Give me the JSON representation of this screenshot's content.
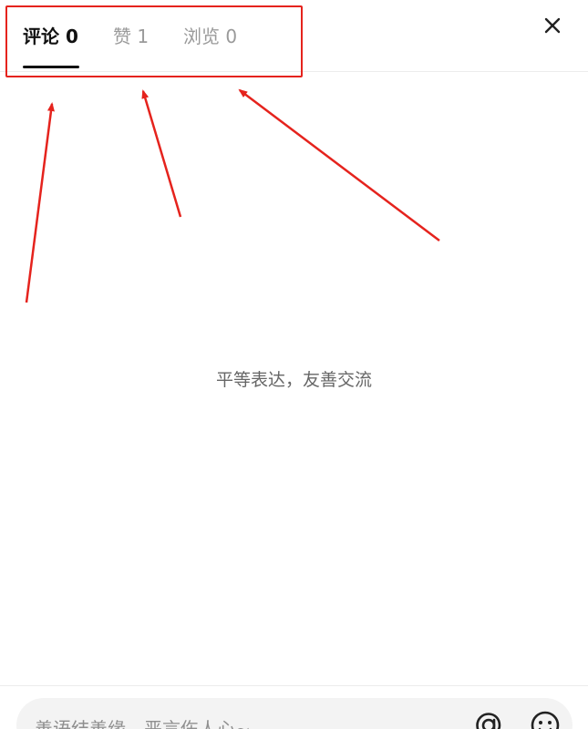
{
  "tabs": [
    {
      "label": "评论 0",
      "active": true
    },
    {
      "label": "赞 1",
      "active": false
    },
    {
      "label": "浏览 0",
      "active": false
    }
  ],
  "close_icon": "close-icon",
  "empty_state": {
    "text": "平等表达，友善交流"
  },
  "comment_bar": {
    "placeholder": "善语结善缘，恶言伤人心~",
    "at_icon": "at-icon",
    "emoji_icon": "emoji-icon"
  },
  "colors": {
    "annotation": "#e5231d",
    "active_tab": "#111111",
    "inactive_tab": "#9a9a9a"
  }
}
